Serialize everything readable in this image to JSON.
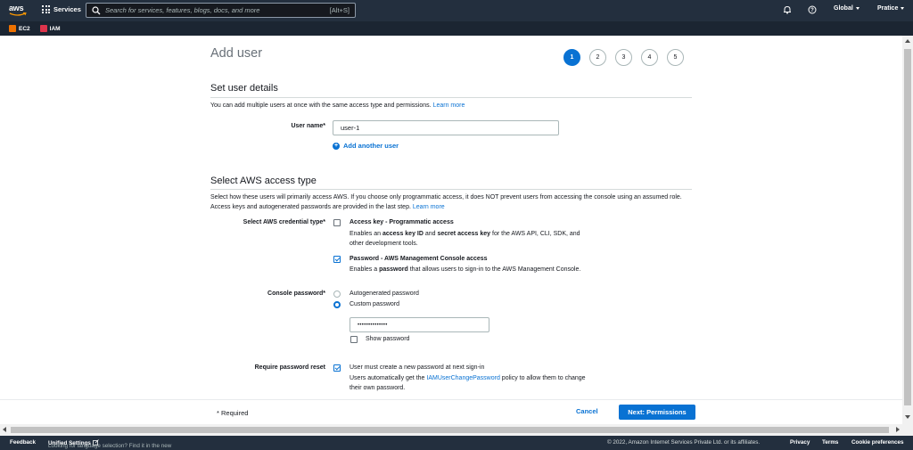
{
  "topnav": {
    "logo_text": "aws",
    "services_label": "Services",
    "search_placeholder": "Search for services, features, blogs, docs, and more",
    "search_shortcut": "[Alt+S]",
    "region_label": "Global",
    "account_label": "Pratice"
  },
  "favorites": [
    {
      "label": "EC2",
      "color": "#ed7100"
    },
    {
      "label": "IAM",
      "color": "#dd344c"
    }
  ],
  "page": {
    "title": "Add user",
    "steps": [
      "1",
      "2",
      "3",
      "4",
      "5"
    ],
    "active_step": "1"
  },
  "user_details": {
    "heading": "Set user details",
    "description": "You can add multiple users at once with the same access type and permissions.",
    "learn_more": "Learn more",
    "username_label": "User name*",
    "username_value": "user-1",
    "add_another": "Add another user"
  },
  "access_type": {
    "heading": "Select AWS access type",
    "description_line1": "Select how these users will primarily access AWS. If you choose only programmatic access, it does NOT prevent users from accessing the console using",
    "description_line2": "an assumed role. Access keys and autogenerated passwords are provided in the last step.",
    "learn_more": "Learn more",
    "credential_label": "Select AWS credential type*",
    "access_key": {
      "title": "Access key - Programmatic access",
      "desc_pre": "Enables an ",
      "desc_b1": "access key ID",
      "desc_mid": " and ",
      "desc_b2": "secret access key",
      "desc_post": " for the AWS API, CLI, SDK, and",
      "desc_line2": "other development tools.",
      "checked": false
    },
    "console_access": {
      "title": "Password - AWS Management Console access",
      "desc_pre": "Enables a ",
      "desc_b": "password",
      "desc_post": " that allows users to sign-in to the AWS Management Console.",
      "checked": true
    },
    "console_password_label": "Console password*",
    "autogenerated": "Autogenerated password",
    "custom": "Custom password",
    "password_value": "••••••••••••••",
    "show_password": "Show password",
    "reset_label": "Require password reset",
    "reset_text": "User must create a new password at next sign-in",
    "reset_desc_pre": "Users automatically get the ",
    "reset_policy_link": "IAMUserChangePassword",
    "reset_desc_post": " policy to allow them to change",
    "reset_desc_line2": "their own password."
  },
  "actions": {
    "required_note": "* Required",
    "cancel": "Cancel",
    "next": "Next: Permissions"
  },
  "footer": {
    "feedback": "Feedback",
    "language_note": "Looking for language selection? Find it in the new",
    "unified_settings": "Unified Settings",
    "copyright": "© 2022, Amazon Internet Services Private Ltd. or its affiliates.",
    "privacy": "Privacy",
    "terms": "Terms",
    "cookies": "Cookie preferences"
  },
  "colors": {
    "nav_bg": "#232f3e",
    "primary": "#0972d3"
  }
}
